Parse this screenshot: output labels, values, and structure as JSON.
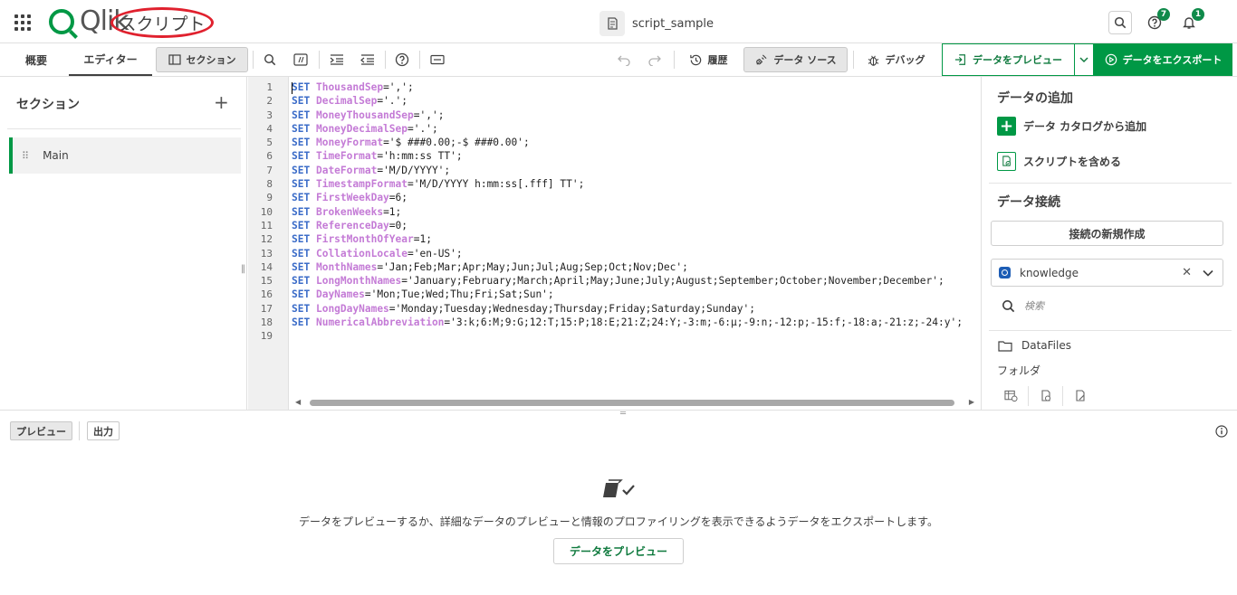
{
  "header": {
    "logo_text": "Qlik",
    "app_title": "スクリプト",
    "document_name": "script_sample",
    "help_badge": "7",
    "notification_badge": "1"
  },
  "toolbar": {
    "tabs": [
      {
        "label": "概要"
      },
      {
        "label": "エディター"
      }
    ],
    "section_toggle_label": "セクション",
    "history_label": "履歴",
    "datasource_label": "データ ソース",
    "debug_label": "デバッグ",
    "preview_label": "データをプレビュー",
    "export_label": "データをエクスポート"
  },
  "sections_panel": {
    "title": "セクション",
    "add_symbol": "+",
    "items": [
      {
        "label": "Main"
      }
    ]
  },
  "editor": {
    "line_numbers": [
      "1",
      "2",
      "3",
      "4",
      "5",
      "6",
      "7",
      "8",
      "9",
      "10",
      "11",
      "12",
      "13",
      "14",
      "15",
      "16",
      "17",
      "18",
      "19"
    ],
    "lines": [
      {
        "kw": "SET",
        "var": "ThousandSep",
        "val": "=',';"
      },
      {
        "kw": "SET",
        "var": "DecimalSep",
        "val": "='.';"
      },
      {
        "kw": "SET",
        "var": "MoneyThousandSep",
        "val": "=',';"
      },
      {
        "kw": "SET",
        "var": "MoneyDecimalSep",
        "val": "='.';"
      },
      {
        "kw": "SET",
        "var": "MoneyFormat",
        "val": "='$ ###0.00;-$ ###0.00';"
      },
      {
        "kw": "SET",
        "var": "TimeFormat",
        "val": "='h:mm:ss TT';"
      },
      {
        "kw": "SET",
        "var": "DateFormat",
        "val": "='M/D/YYYY';"
      },
      {
        "kw": "SET",
        "var": "TimestampFormat",
        "val": "='M/D/YYYY h:mm:ss[.fff] TT';"
      },
      {
        "kw": "SET",
        "var": "FirstWeekDay",
        "val": "=6;"
      },
      {
        "kw": "SET",
        "var": "BrokenWeeks",
        "val": "=1;"
      },
      {
        "kw": "SET",
        "var": "ReferenceDay",
        "val": "=0;"
      },
      {
        "kw": "SET",
        "var": "FirstMonthOfYear",
        "val": "=1;"
      },
      {
        "kw": "SET",
        "var": "CollationLocale",
        "val": "='en-US';"
      },
      {
        "kw": "SET",
        "var": "MonthNames",
        "val": "='Jan;Feb;Mar;Apr;May;Jun;Jul;Aug;Sep;Oct;Nov;Dec';"
      },
      {
        "kw": "SET",
        "var": "LongMonthNames",
        "val": "='January;February;March;April;May;June;July;August;September;October;November;December';"
      },
      {
        "kw": "SET",
        "var": "DayNames",
        "val": "='Mon;Tue;Wed;Thu;Fri;Sat;Sun';"
      },
      {
        "kw": "SET",
        "var": "LongDayNames",
        "val": "='Monday;Tuesday;Wednesday;Thursday;Friday;Saturday;Sunday';"
      },
      {
        "kw": "SET",
        "var": "NumericalAbbreviation",
        "val": "='3:k;6:M;9:G;12:T;15:P;18:E;21:Z;24:Y;-3:m;-6:μ;-9:n;-12:p;-15:f;-18:a;-21:z;-24:y';"
      },
      {
        "kw": "",
        "var": "",
        "val": ""
      }
    ]
  },
  "right_panel": {
    "add_data_title": "データの追加",
    "add_from_catalog": "データ カタログから追加",
    "include_script": "スクリプトを含める",
    "data_connections_title": "データ接続",
    "new_connection": "接続の新規作成",
    "space_value": "knowledge",
    "search_placeholder": "検索",
    "folder_name": "DataFiles",
    "folder_type": "フォルダ"
  },
  "bottom": {
    "tabs": [
      {
        "label": "プレビュー"
      },
      {
        "label": "出力"
      }
    ],
    "empty_message": "データをプレビューするか、詳細なデータのプレビューと情報のプロファイリングを表示できるようデータをエクスポートします。",
    "empty_button": "データをプレビュー"
  },
  "colors": {
    "brand_green": "#009845",
    "keyword_blue": "#3b6cc8",
    "variable_purple": "#c47bd6",
    "annotation_red": "#e0212e"
  }
}
